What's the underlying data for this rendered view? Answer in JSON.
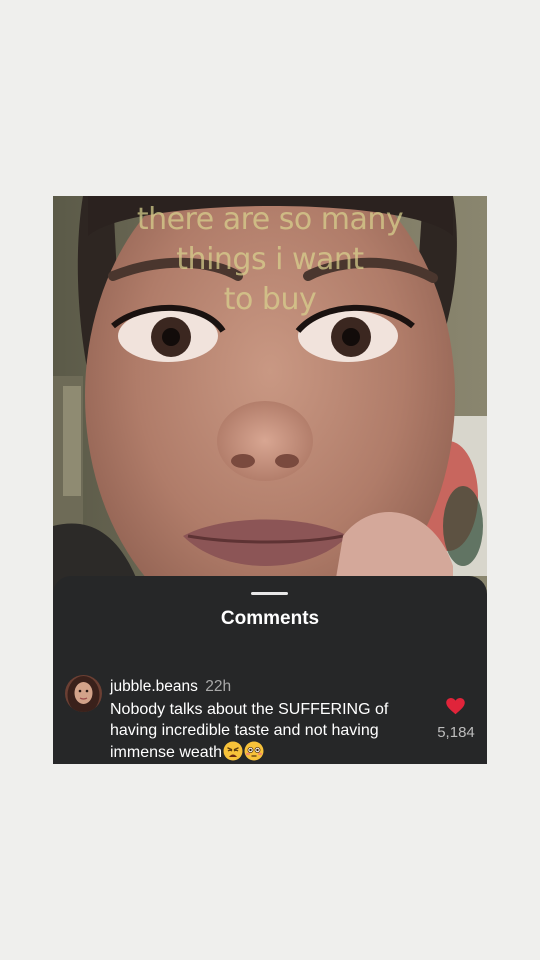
{
  "video": {
    "caption_lines": [
      "there are so many",
      "things i want",
      "to buy"
    ]
  },
  "comments_sheet": {
    "title": "Comments",
    "comment": {
      "username": "jubble.beans",
      "time": "22h",
      "text": "Nobody talks about the SUFFERING of having incredible taste and not having immense weath",
      "emojis": [
        "weary-face",
        "flushed-face"
      ],
      "like_count": "5,184",
      "like_color": "#e0243a"
    }
  },
  "colors": {
    "page_background": "#efefed",
    "sheet_background": "#262728",
    "caption_color": "#d9d28e"
  }
}
